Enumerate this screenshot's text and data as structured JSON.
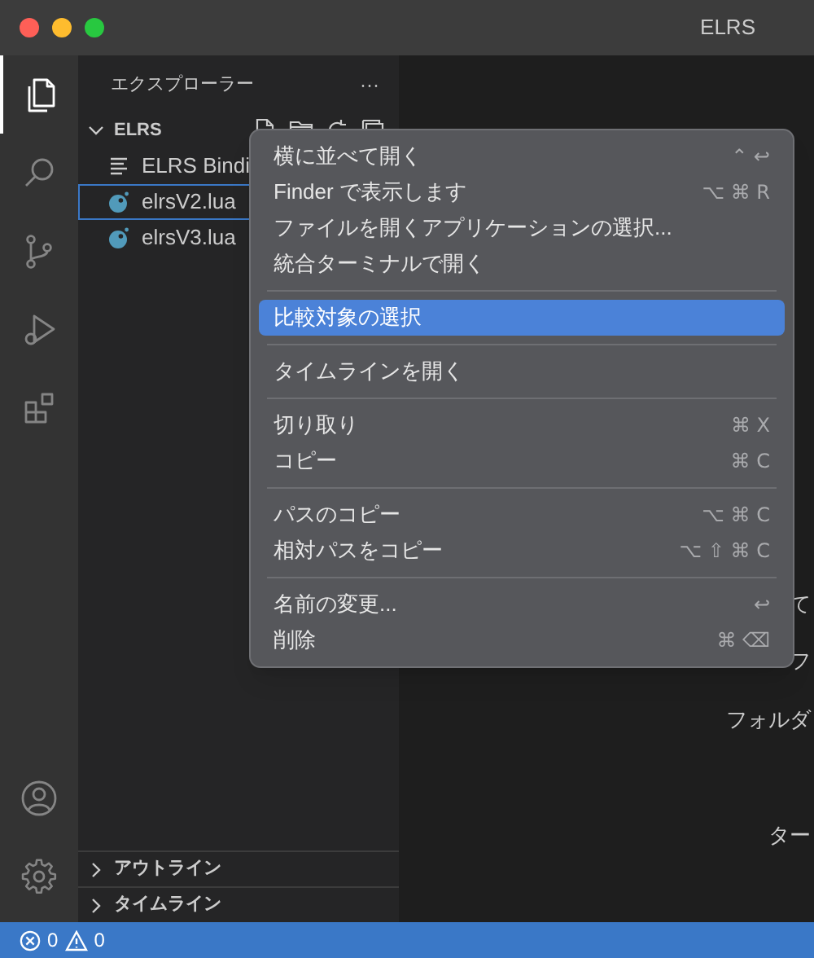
{
  "window": {
    "title": "ELRS"
  },
  "activity_bar": {
    "top": [
      {
        "kind": "files",
        "selected": true
      },
      {
        "kind": "search",
        "selected": false
      },
      {
        "kind": "source-control",
        "selected": false
      },
      {
        "kind": "run",
        "selected": false
      },
      {
        "kind": "extensions",
        "selected": false
      }
    ],
    "bottom": [
      {
        "kind": "account"
      },
      {
        "kind": "settings"
      }
    ]
  },
  "sidebar": {
    "title": "エクスプローラー",
    "more": "···",
    "folder": {
      "name": "ELRS",
      "expanded": true,
      "children": [
        {
          "name": "ELRS Bindi",
          "kind": "text",
          "focused": false
        },
        {
          "name": "elrsV2.lua",
          "kind": "lua",
          "focused": true
        },
        {
          "name": "elrsV3.lua",
          "kind": "lua",
          "focused": false
        }
      ]
    },
    "sections": [
      {
        "name": "アウトライン",
        "expanded": false
      },
      {
        "name": "タイムライン",
        "expanded": false
      }
    ]
  },
  "editor": {
    "fragments": [
      "て",
      "フ",
      "フォルダ",
      "ター"
    ]
  },
  "context_menu": {
    "items": [
      {
        "kind": "item",
        "label": "横に並べて開く",
        "shortcut": "⌃ ↩",
        "selected": false
      },
      {
        "kind": "item",
        "label": "Finder で表示します",
        "shortcut": "⌥ ⌘ R",
        "selected": false
      },
      {
        "kind": "item",
        "label": "ファイルを開くアプリケーションの選択...",
        "selected": false
      },
      {
        "kind": "item",
        "label": "統合ターミナルで開く",
        "selected": false
      },
      {
        "kind": "separator"
      },
      {
        "kind": "item",
        "label": "比較対象の選択",
        "selected": true
      },
      {
        "kind": "separator"
      },
      {
        "kind": "item",
        "label": "タイムラインを開く",
        "selected": false
      },
      {
        "kind": "separator"
      },
      {
        "kind": "item",
        "label": "切り取り",
        "shortcut": "⌘ X",
        "selected": false
      },
      {
        "kind": "item",
        "label": "コピー",
        "shortcut": "⌘ C",
        "selected": false
      },
      {
        "kind": "separator"
      },
      {
        "kind": "item",
        "label": "パスのコピー",
        "shortcut": "⌥ ⌘ C",
        "selected": false
      },
      {
        "kind": "item",
        "label": "相対パスをコピー",
        "shortcut": "⌥ ⇧ ⌘ C",
        "selected": false
      },
      {
        "kind": "separator"
      },
      {
        "kind": "item",
        "label": "名前の変更...",
        "shortcut": "↩",
        "selected": false
      },
      {
        "kind": "item",
        "label": "削除",
        "shortcut": "⌘ ⌫",
        "selected": false
      }
    ]
  },
  "status_bar": {
    "errors": "0",
    "warnings": "0"
  }
}
